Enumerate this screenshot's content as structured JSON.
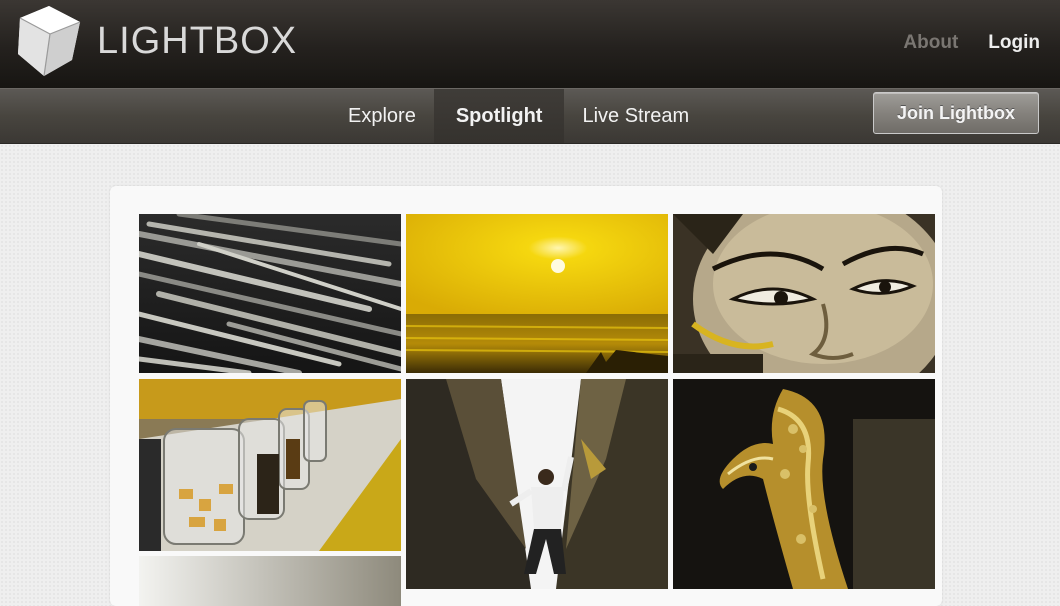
{
  "header": {
    "logo_text": "LIGHTBOX",
    "links": {
      "about": "About",
      "login": "Login"
    }
  },
  "nav": {
    "tabs": [
      {
        "label": "Explore",
        "active": false
      },
      {
        "label": "Spotlight",
        "active": true
      },
      {
        "label": "Live Stream",
        "active": false
      }
    ],
    "join_label": "Join Lightbox"
  },
  "gallery": {
    "photos": [
      {
        "subject": "asparagus"
      },
      {
        "subject": "yellow sunset over sea"
      },
      {
        "subject": "golden buddha face"
      },
      {
        "subject": "glass jars"
      },
      {
        "subject": "man between walls"
      },
      {
        "subject": "golden dragon carving"
      }
    ]
  },
  "colors": {
    "header_dark": "#24211e",
    "nav_gray": "#48453f",
    "accent_yellow": "#e8c410"
  }
}
